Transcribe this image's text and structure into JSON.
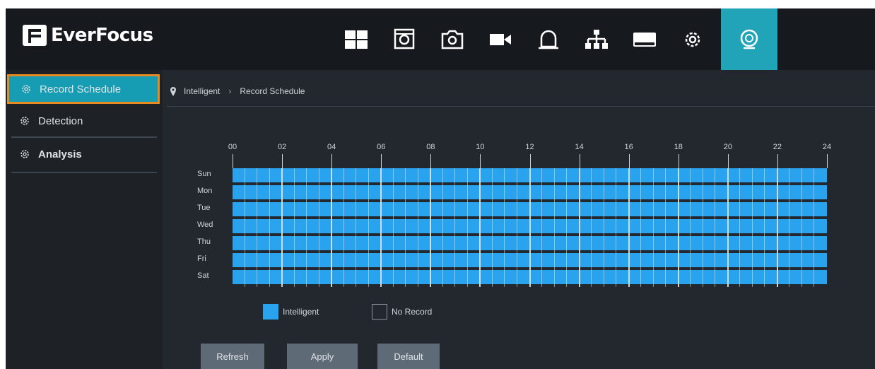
{
  "app": {
    "brand": "EverFocus"
  },
  "topnav": {
    "items": [
      {
        "icon": "live-view-grid-icon"
      },
      {
        "icon": "playback-icon"
      },
      {
        "icon": "snapshot-camera-icon"
      },
      {
        "icon": "record-camera-icon"
      },
      {
        "icon": "alarm-bell-icon"
      },
      {
        "icon": "network-icon"
      },
      {
        "icon": "storage-disk-icon"
      },
      {
        "icon": "settings-gear-icon"
      },
      {
        "icon": "intelligent-icon",
        "active": true
      }
    ],
    "accent": "#21a4b7"
  },
  "sidebar": {
    "items": [
      {
        "label": "Record Schedule",
        "active": true
      },
      {
        "label": "Detection"
      },
      {
        "label": "Analysis"
      }
    ]
  },
  "breadcrumb": {
    "root": "Intelligent",
    "current": "Record Schedule"
  },
  "schedule": {
    "hours": [
      "00",
      "02",
      "04",
      "06",
      "08",
      "10",
      "12",
      "14",
      "16",
      "18",
      "20",
      "22",
      "24"
    ],
    "days": [
      "Sun",
      "Mon",
      "Tue",
      "Wed",
      "Thu",
      "Fri",
      "Sat"
    ],
    "fill_color": "#2aa3ee",
    "mode": "Intelligent"
  },
  "legend": {
    "intelligent": "Intelligent",
    "no_record": "No Record"
  },
  "buttons": {
    "refresh": "Refresh",
    "apply": "Apply",
    "default": "Default"
  }
}
